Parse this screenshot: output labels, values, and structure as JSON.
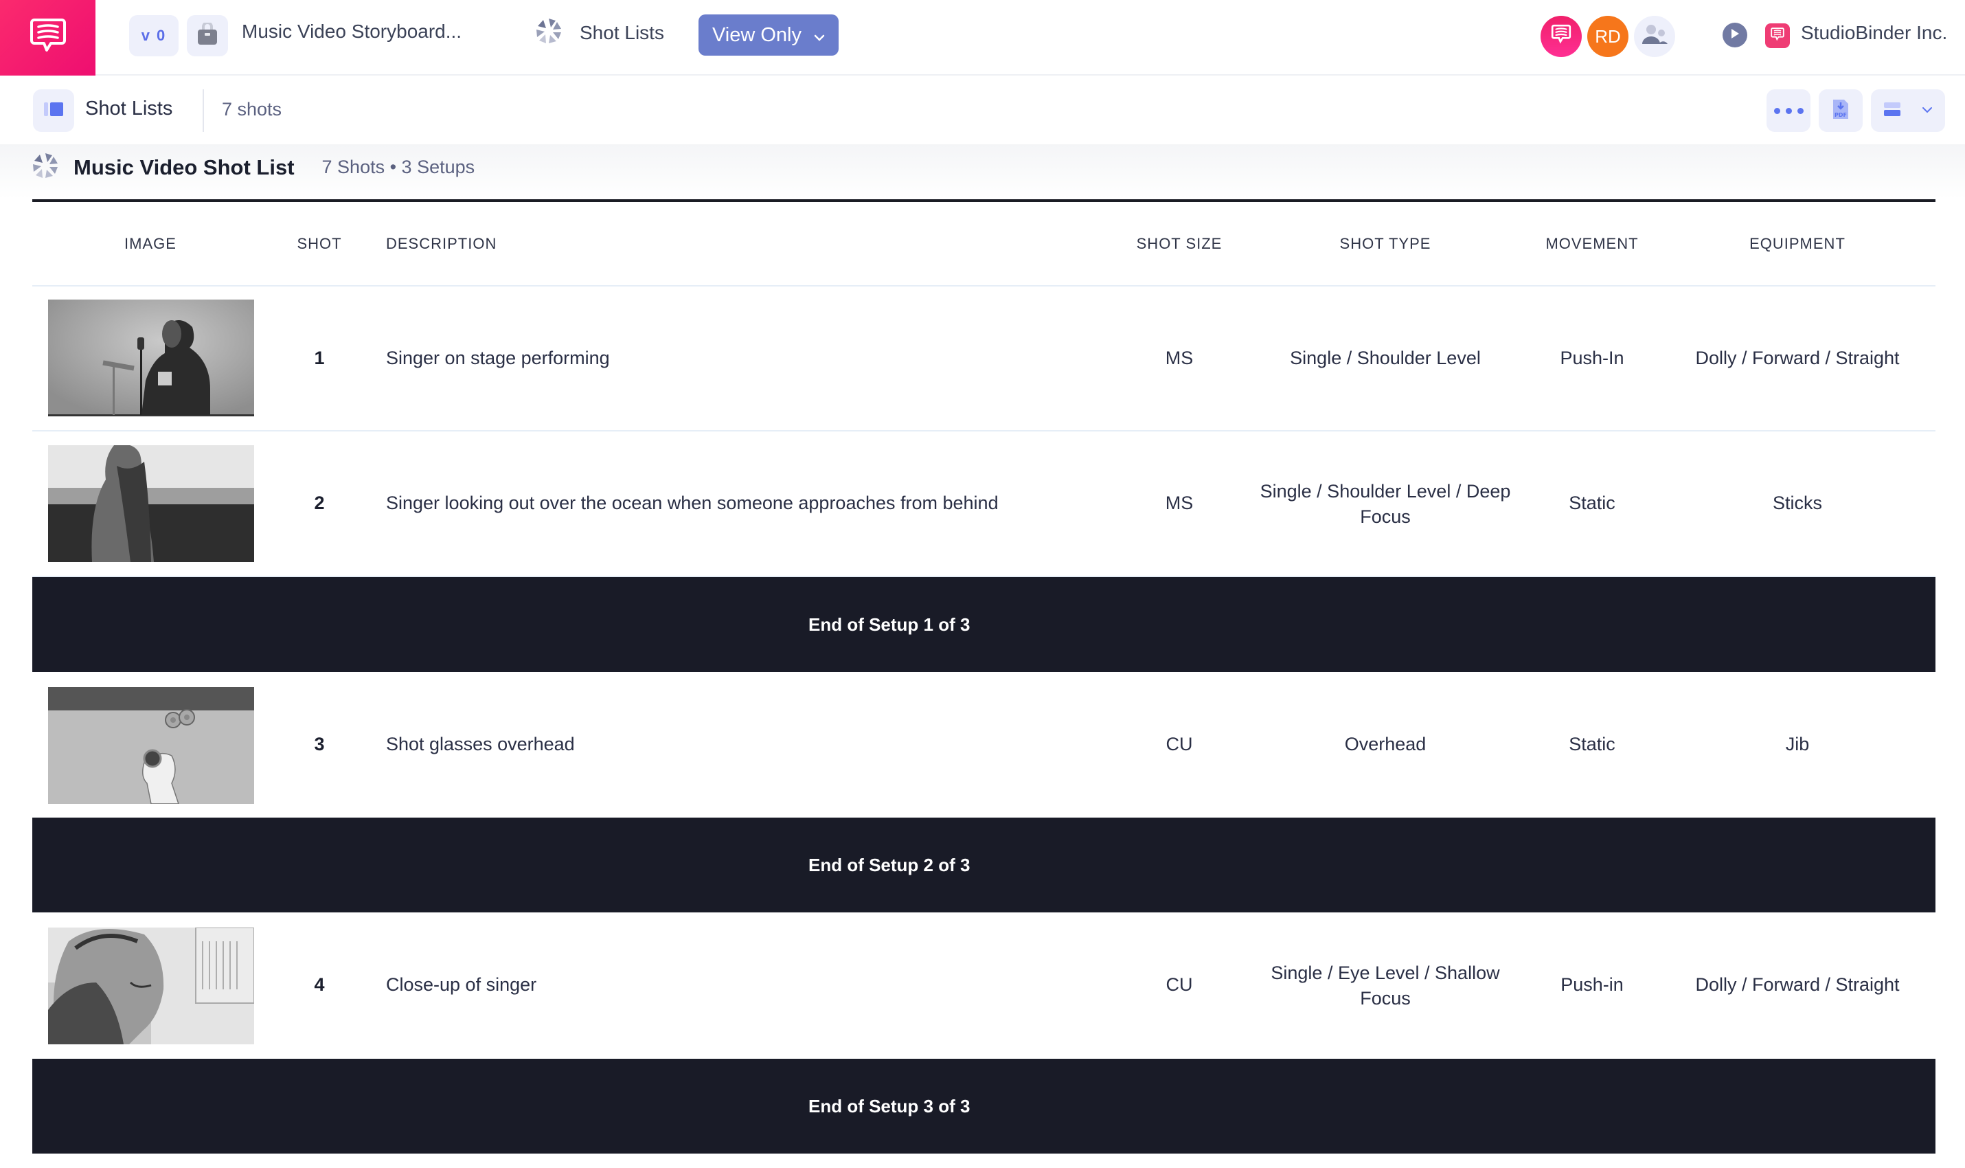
{
  "topbar": {
    "logo_icon": "studiobinder-chat-icon",
    "version": "v 0",
    "project_icon": "briefcase-icon",
    "project_title": "Music Video Storyboard...",
    "nav_icon": "aperture-icon",
    "nav_label": "Shot Lists",
    "view_only_label": "View Only",
    "avatars": [
      {
        "type": "brand",
        "icon": "studiobinder-chat-icon"
      },
      {
        "type": "initials",
        "text": "RD"
      },
      {
        "type": "team",
        "icon": "team-icon"
      }
    ],
    "org_name": "StudioBinder Inc.",
    "colors": {
      "brand": "#f0156e",
      "accent": "#6a7dcc",
      "avatar_rd": "#f6761b"
    }
  },
  "subheader": {
    "title": "Shot Lists",
    "count": "7 shots",
    "tools": [
      "more-icon",
      "pdf-download-icon",
      "layout-toggle-icon"
    ]
  },
  "sheet": {
    "title": "Music Video Shot List",
    "meta": "7 Shots • 3 Setups",
    "columns": {
      "image": "IMAGE",
      "shot": "SHOT",
      "description": "DESCRIPTION",
      "shot_size": "SHOT SIZE",
      "shot_type": "SHOT TYPE",
      "movement": "MOVEMENT",
      "equipment": "EQUIPMENT"
    },
    "rows": [
      {
        "shot": "1",
        "description": "Singer on stage performing",
        "shot_size": "MS",
        "shot_type": "Single / Shoulder Level",
        "movement": "Push-In",
        "equipment": "Dolly / Forward / Straight",
        "image": "storyboard-singer-on-stage"
      },
      {
        "shot": "2",
        "description": "Singer looking out over the ocean when someone approaches from behind",
        "shot_size": "MS",
        "shot_type": "Single / Shoulder Level / Deep Focus",
        "movement": "Static",
        "equipment": "Sticks",
        "image": "storyboard-singer-ocean"
      },
      {
        "shot": "3",
        "description": "Shot glasses overhead",
        "shot_size": "CU",
        "shot_type": "Overhead",
        "movement": "Static",
        "equipment": "Jib",
        "image": "storyboard-shot-glasses"
      },
      {
        "shot": "4",
        "description": "Close-up of singer",
        "shot_size": "CU",
        "shot_type": "Single / Eye Level / Shallow Focus",
        "movement": "Push-in",
        "equipment": "Dolly / Forward / Straight",
        "image": "storyboard-singer-closeup"
      }
    ],
    "setups": [
      "End of  Setup 1 of 3",
      "End of  Setup 2 of 3",
      "End of  Setup 3 of 3"
    ]
  }
}
